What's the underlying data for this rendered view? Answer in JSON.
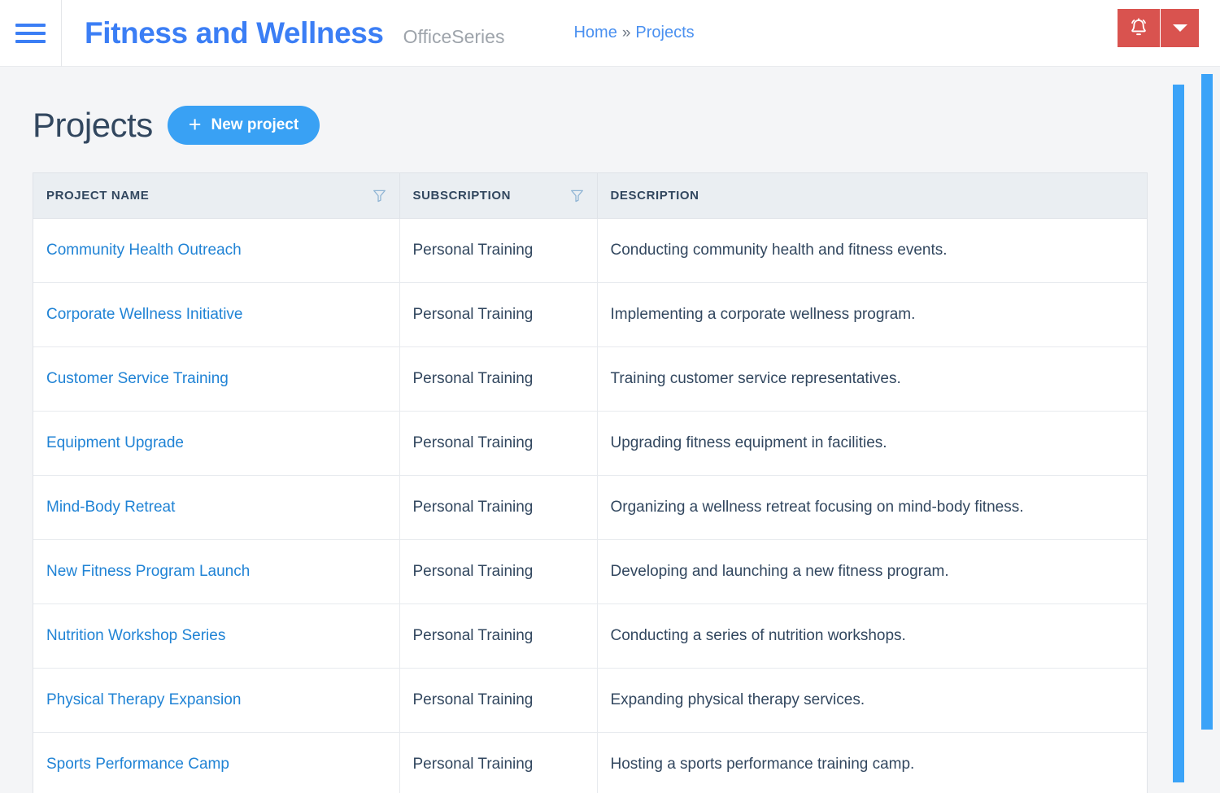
{
  "header": {
    "menu_icon": "hamburger-menu-icon",
    "app_title": "Fitness and Wellness",
    "app_subtitle": "OfficeSeries",
    "breadcrumb": {
      "home": "Home",
      "separator": "»",
      "current": "Projects"
    },
    "notification": {
      "icon": "bell-icon",
      "caret_icon": "chevron-down-icon",
      "color": "#d9534f"
    }
  },
  "page": {
    "title": "Projects",
    "new_project_button": {
      "label": "New project",
      "plus": "+",
      "color": "#39a1f4"
    }
  },
  "table": {
    "columns": [
      {
        "label": "PROJECT NAME",
        "filter_icon": "filter-funnel-icon",
        "has_filter": true
      },
      {
        "label": "SUBSCRIPTION",
        "filter_icon": "filter-funnel-icon",
        "has_filter": true
      },
      {
        "label": "DESCRIPTION",
        "filter_icon": "",
        "has_filter": false
      }
    ],
    "rows": [
      {
        "name": "Community Health Outreach",
        "subscription": "Personal Training",
        "description": "Conducting community health and fitness events."
      },
      {
        "name": "Corporate Wellness Initiative",
        "subscription": "Personal Training",
        "description": "Implementing a corporate wellness program."
      },
      {
        "name": "Customer Service Training",
        "subscription": "Personal Training",
        "description": "Training customer service representatives."
      },
      {
        "name": "Equipment Upgrade",
        "subscription": "Personal Training",
        "description": "Upgrading fitness equipment in facilities."
      },
      {
        "name": "Mind-Body Retreat",
        "subscription": "Personal Training",
        "description": "Organizing a wellness retreat focusing on mind-body fitness."
      },
      {
        "name": "New Fitness Program Launch",
        "subscription": "Personal Training",
        "description": "Developing and launching a new fitness program."
      },
      {
        "name": "Nutrition Workshop Series",
        "subscription": "Personal Training",
        "description": "Conducting a series of nutrition workshops."
      },
      {
        "name": "Physical Therapy Expansion",
        "subscription": "Personal Training",
        "description": "Expanding physical therapy services."
      },
      {
        "name": "Sports Performance Camp",
        "subscription": "Personal Training",
        "description": "Hosting a sports performance training camp."
      }
    ]
  },
  "scrollbars": {
    "inner": "inner-vertical-scrollbar",
    "outer": "outer-vertical-scrollbar",
    "color": "#3ba3f8"
  }
}
